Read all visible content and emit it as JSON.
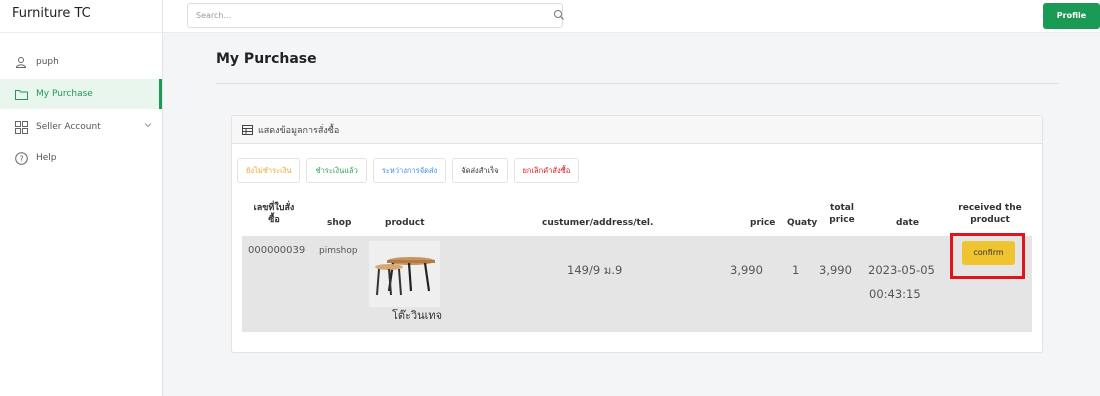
{
  "sidebar": {
    "brand": "Furniture TC",
    "items": [
      {
        "label": "puph",
        "icon": "user-icon"
      },
      {
        "label": "My Purchase",
        "icon": "folder-icon"
      },
      {
        "label": "Seller Account",
        "icon": "grid-icon"
      },
      {
        "label": "Help",
        "icon": "help-icon"
      }
    ]
  },
  "topbar": {
    "search_placeholder": "Search...",
    "profile_label": "Profile"
  },
  "main": {
    "title": "My Purchase",
    "card_title": "แสดงข้อมูลการสั่งซื้อ",
    "tabs": [
      {
        "label": "ยังไม่ชำระเงิน",
        "color": "#f0a830"
      },
      {
        "label": "ชำระเงินแล้ว",
        "color": "#2ea85a"
      },
      {
        "label": "ระหว่างการจัดส่ง",
        "color": "#3a8ee6"
      },
      {
        "label": "จัดส่งสำเร็จ",
        "color": "#333333"
      },
      {
        "label": "ยกเลิกคำสั่งซื้อ",
        "color": "#e0141c"
      }
    ],
    "columns": {
      "order_no_1": "เลขที่ใบสั่ง",
      "order_no_2": "ซื้อ",
      "shop": "shop",
      "product": "product",
      "customer": "custumer/address/tel.",
      "price": "price",
      "qty": "Quaty",
      "total_1": "total",
      "total_2": "price",
      "date": "date",
      "received_1": "received the",
      "received_2": "product"
    },
    "row": {
      "order_no": "000000039",
      "shop": "pimshop",
      "product_name": "โต๊ะวินเทจ",
      "address": "149/9 ม.9",
      "price": "3,990",
      "qty": "1",
      "total": "3,990",
      "date": "2023-05-05",
      "time": "00:43:15",
      "action_label": "confirm"
    }
  },
  "colors": {
    "accent": "#1a9a55",
    "confirm": "#f0c330",
    "highlight": "#e0141c"
  }
}
